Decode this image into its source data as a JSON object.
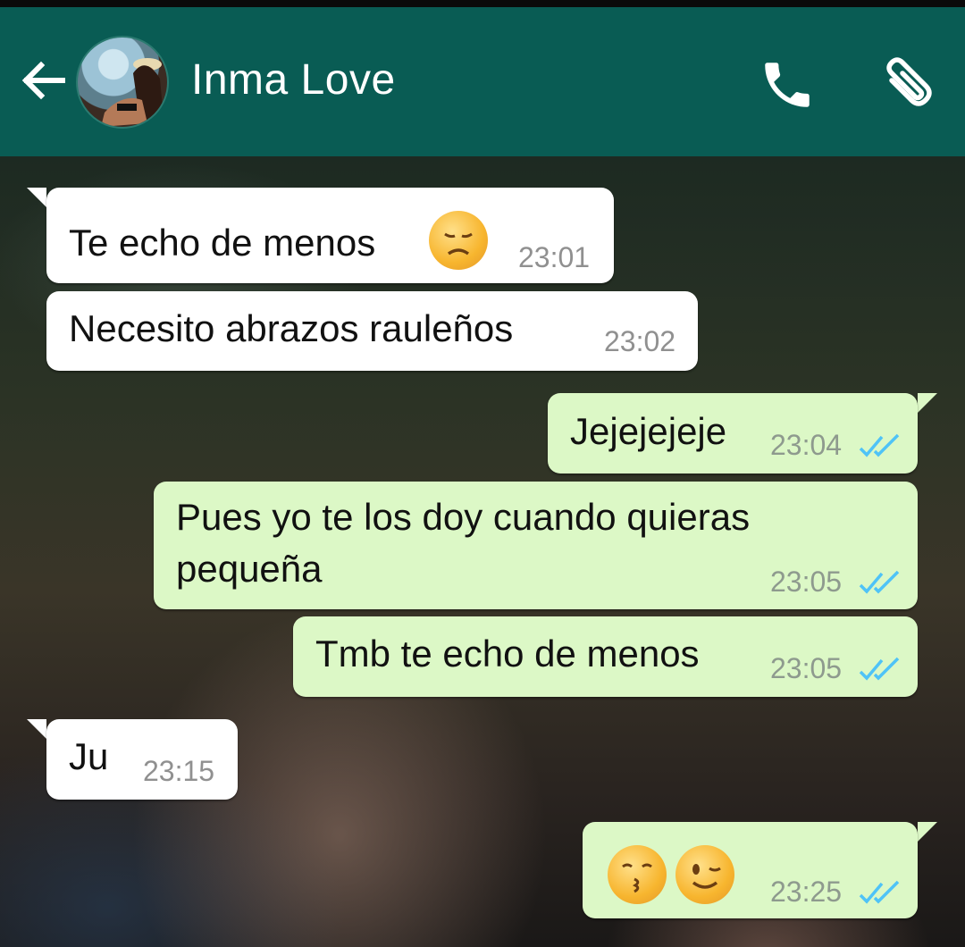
{
  "header": {
    "contact_name": "Inma Love",
    "back_icon": "arrow-left-icon",
    "call_icon": "phone-icon",
    "attach_icon": "paperclip-icon",
    "color": "#095c54"
  },
  "messages": [
    {
      "direction": "incoming",
      "text": "Te echo de menos",
      "emoji": "disappointed-face",
      "time": "23:01"
    },
    {
      "direction": "incoming",
      "text": "Necesito abrazos rauleños",
      "time": "23:02"
    },
    {
      "direction": "outgoing",
      "text": "Jejejejeje",
      "time": "23:04",
      "status": "read"
    },
    {
      "direction": "outgoing",
      "text_line1": "Pues yo te los doy cuando quieras",
      "text_line2": "pequeña",
      "time": "23:05",
      "status": "read"
    },
    {
      "direction": "outgoing",
      "text": "Tmb te echo de menos",
      "time": "23:05",
      "status": "read"
    },
    {
      "direction": "incoming",
      "text": "Ju",
      "time": "23:15"
    },
    {
      "direction": "outgoing",
      "emojis": [
        "kissing-face",
        "winking-face"
      ],
      "time": "23:25",
      "status": "read"
    }
  ],
  "colors": {
    "incoming_bubble": "#ffffff",
    "outgoing_bubble": "#dcf8c6",
    "read_ticks": "#4fc3f7"
  }
}
